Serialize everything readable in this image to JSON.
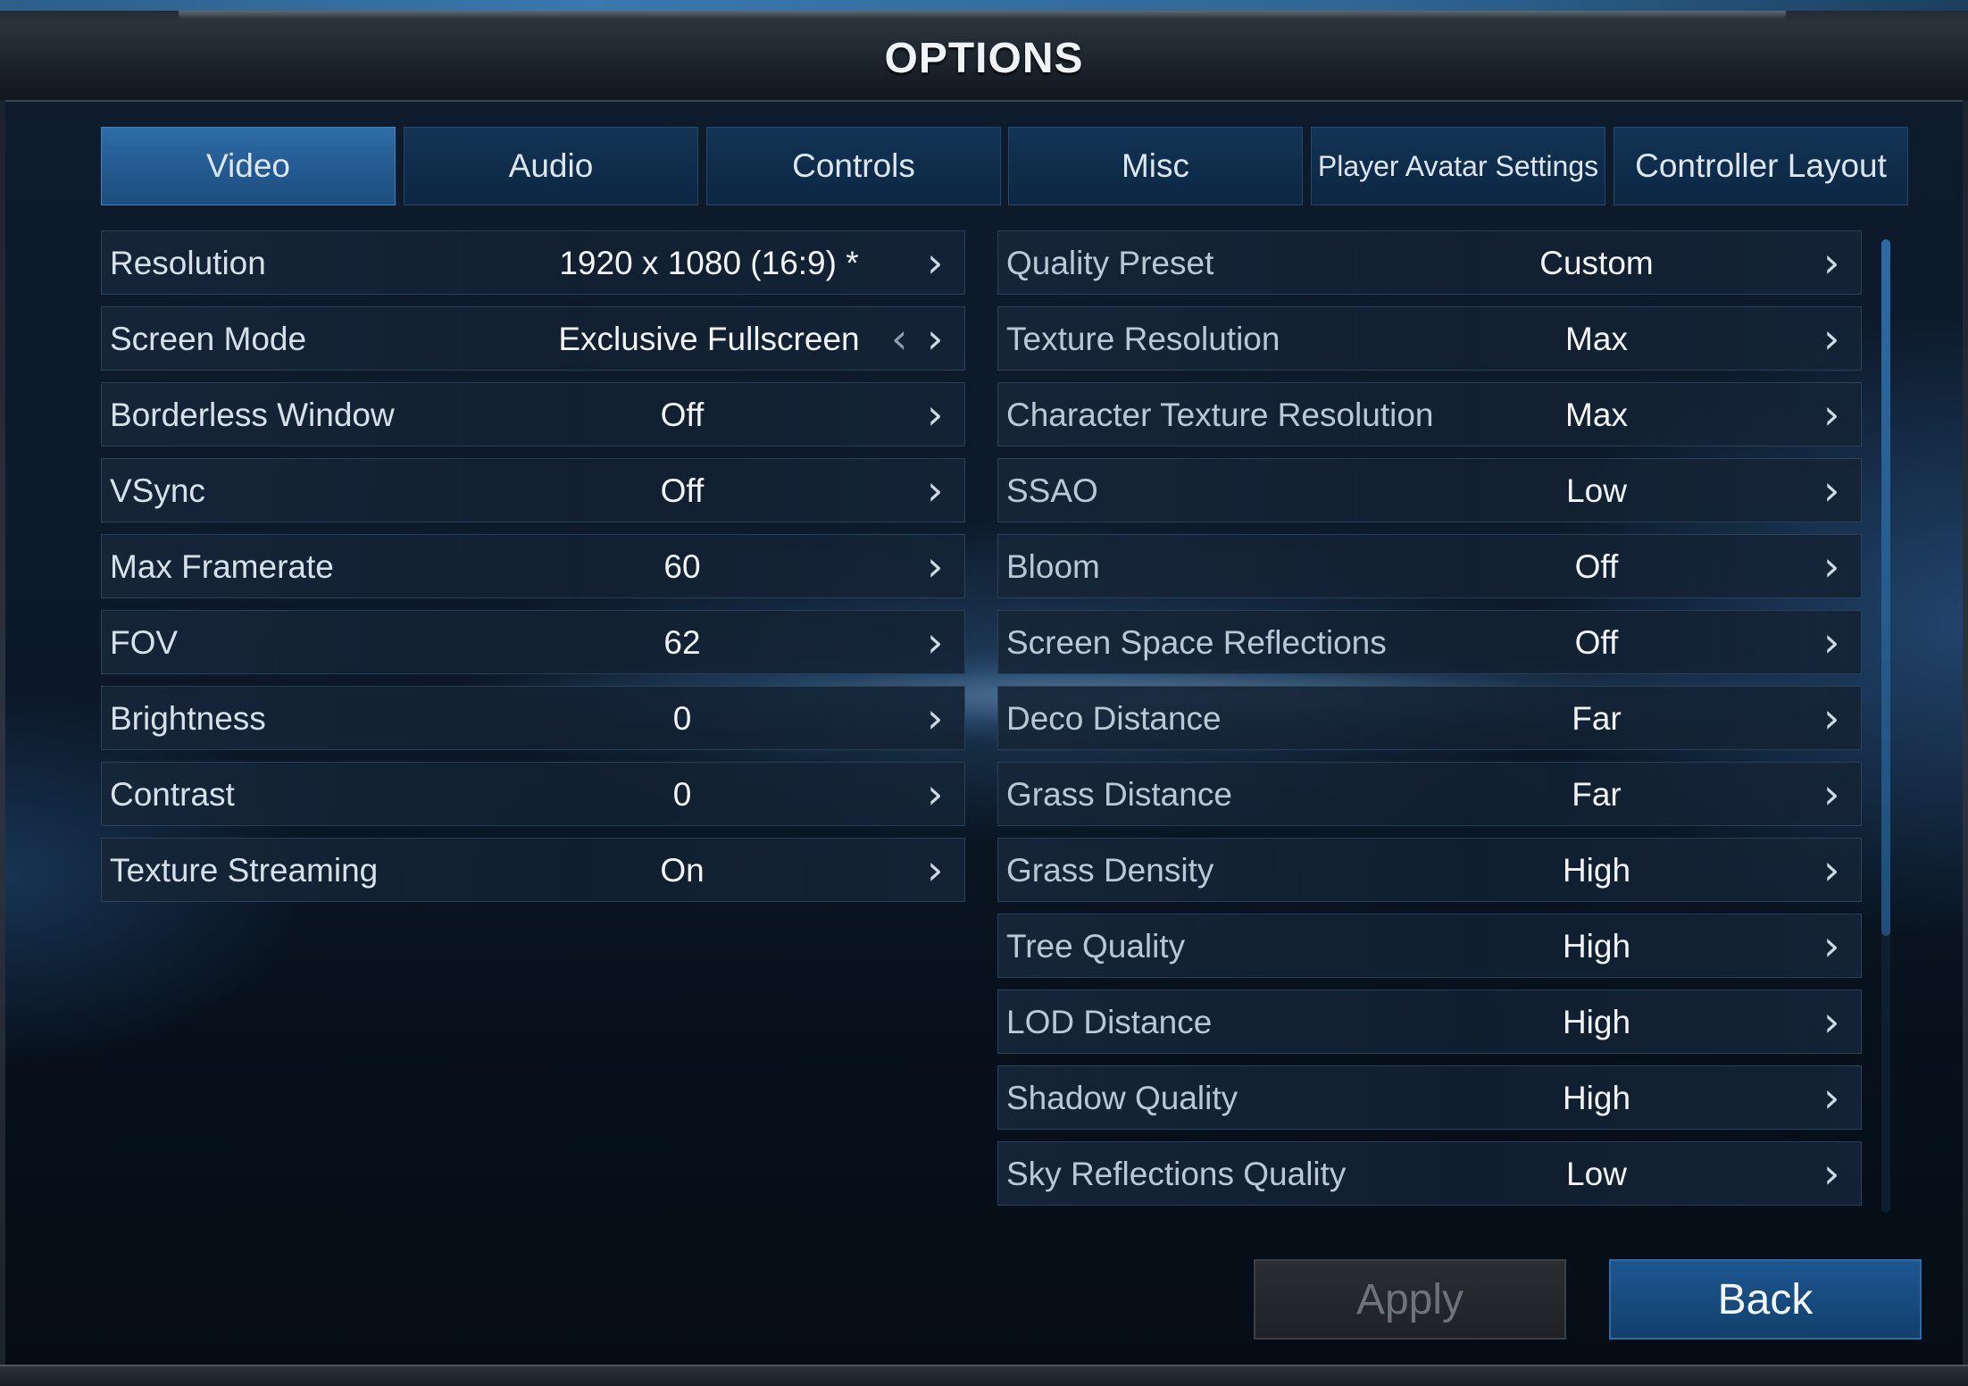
{
  "title": "OPTIONS",
  "tabs": [
    {
      "label": "Video",
      "active": true
    },
    {
      "label": "Audio",
      "active": false
    },
    {
      "label": "Controls",
      "active": false
    },
    {
      "label": "Misc",
      "active": false
    },
    {
      "label": "Player Avatar Settings",
      "active": false
    },
    {
      "label": "Controller Layout",
      "active": false
    }
  ],
  "left_settings": [
    {
      "label": "Resolution",
      "value": "1920 x 1080  (16:9)  *"
    },
    {
      "label": "Screen Mode",
      "value": "Exclusive Fullscreen"
    },
    {
      "label": "Borderless Window",
      "value": "Off"
    },
    {
      "label": "VSync",
      "value": "Off"
    },
    {
      "label": "Max Framerate",
      "value": "60"
    },
    {
      "label": "FOV",
      "value": "62"
    },
    {
      "label": "Brightness",
      "value": "0"
    },
    {
      "label": "Contrast",
      "value": "0"
    },
    {
      "label": "Texture Streaming",
      "value": "On"
    }
  ],
  "right_settings": [
    {
      "label": "Quality Preset",
      "value": "Custom"
    },
    {
      "label": "Texture Resolution",
      "value": "Max"
    },
    {
      "label": "Character Texture Resolution",
      "value": "Max"
    },
    {
      "label": "SSAO",
      "value": "Low"
    },
    {
      "label": "Bloom",
      "value": "Off"
    },
    {
      "label": "Screen Space Reflections",
      "value": "Off"
    },
    {
      "label": "Deco Distance",
      "value": "Far"
    },
    {
      "label": "Grass Distance",
      "value": "Far"
    },
    {
      "label": "Grass Density",
      "value": "High"
    },
    {
      "label": "Tree Quality",
      "value": "High"
    },
    {
      "label": "LOD Distance",
      "value": "High"
    },
    {
      "label": "Shadow Quality",
      "value": "High"
    },
    {
      "label": "Sky Reflections Quality",
      "value": "Low"
    }
  ],
  "icons": {
    "next": "chevron-right-icon",
    "prev": "chevron-left-icon"
  },
  "glyphs": {
    "next": "›",
    "prev": "‹"
  },
  "buttons": {
    "apply": "Apply",
    "back": "Back"
  },
  "colors": {
    "active_tab": "#2f6da8",
    "tab": "#133556",
    "back_button": "#1d5790",
    "apply_button_disabled": "#2a2d31"
  }
}
